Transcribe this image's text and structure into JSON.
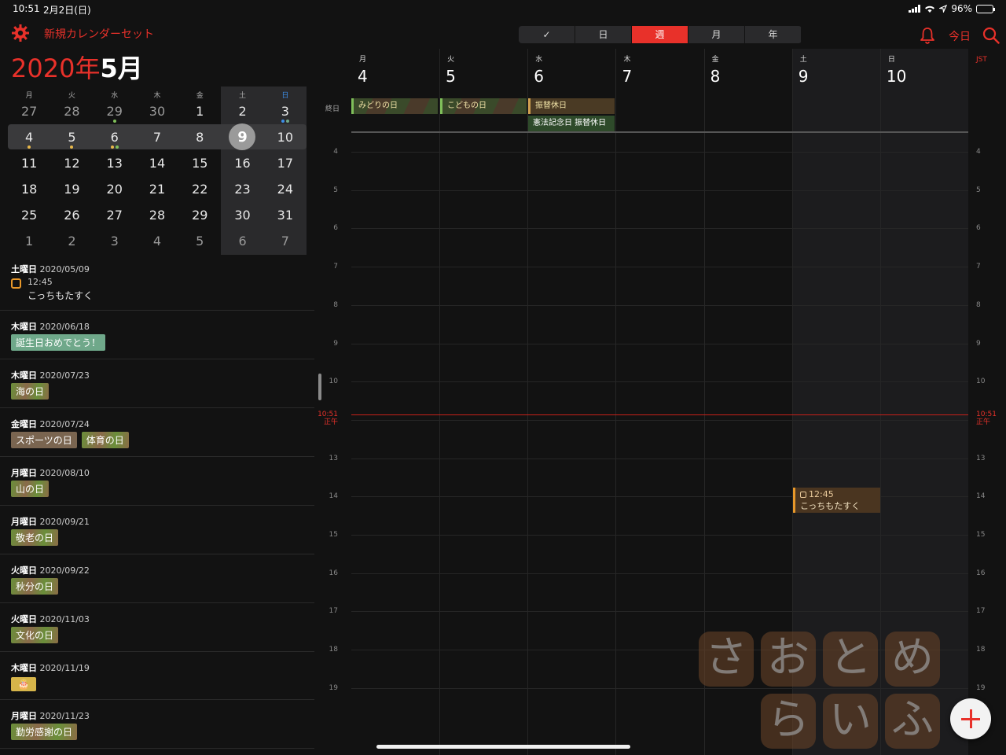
{
  "status": {
    "time": "10:51",
    "date": "2月2日(日)",
    "battery": "96%",
    "battery_level": 0.96
  },
  "left": {
    "calendar_set": "新規カレンダーセット",
    "year": "2020年",
    "month": "5月"
  },
  "minical": {
    "weekdays": [
      "月",
      "火",
      "水",
      "木",
      "金",
      "土",
      "日"
    ],
    "rows": [
      [
        "27",
        "28",
        "29",
        "30",
        "1",
        "2",
        "3"
      ],
      [
        "4",
        "5",
        "6",
        "7",
        "8",
        "9",
        "10"
      ],
      [
        "11",
        "12",
        "13",
        "14",
        "15",
        "16",
        "17"
      ],
      [
        "18",
        "19",
        "20",
        "21",
        "22",
        "23",
        "24"
      ],
      [
        "25",
        "26",
        "27",
        "28",
        "29",
        "30",
        "31"
      ],
      [
        "1",
        "2",
        "3",
        "4",
        "5",
        "6",
        "7"
      ]
    ],
    "today": "9"
  },
  "agenda": [
    {
      "weekday": "土曜日",
      "date": "2020/05/09",
      "task_time": "12:45",
      "task_title": "こっちもたすく"
    },
    {
      "weekday": "木曜日",
      "date": "2020/06/18",
      "chips": [
        "誕生日おめでとう！"
      ]
    },
    {
      "weekday": "木曜日",
      "date": "2020/07/23",
      "chips": [
        "海の日"
      ]
    },
    {
      "weekday": "金曜日",
      "date": "2020/07/24",
      "chips": [
        "スポーツの日",
        "体育の日"
      ]
    },
    {
      "weekday": "月曜日",
      "date": "2020/08/10",
      "chips": [
        "山の日"
      ]
    },
    {
      "weekday": "月曜日",
      "date": "2020/09/21",
      "chips": [
        "敬老の日"
      ]
    },
    {
      "weekday": "火曜日",
      "date": "2020/09/22",
      "chips": [
        "秋分の日"
      ]
    },
    {
      "weekday": "火曜日",
      "date": "2020/11/03",
      "chips": [
        "文化の日"
      ]
    },
    {
      "weekday": "木曜日",
      "date": "2020/11/19",
      "chips": [
        "🎂"
      ]
    },
    {
      "weekday": "月曜日",
      "date": "2020/11/23",
      "chips": [
        "勤労感謝の日"
      ]
    }
  ],
  "toolbar": {
    "segments": [
      "✓",
      "日",
      "週",
      "月",
      "年"
    ],
    "active_segment": "週",
    "today_label": "今日"
  },
  "week": {
    "days": [
      {
        "wd": "月",
        "num": "4"
      },
      {
        "wd": "火",
        "num": "5"
      },
      {
        "wd": "水",
        "num": "6"
      },
      {
        "wd": "木",
        "num": "7"
      },
      {
        "wd": "金",
        "num": "8"
      },
      {
        "wd": "土",
        "num": "9"
      },
      {
        "wd": "日",
        "num": "10"
      }
    ],
    "allday_label": "終日",
    "timezone": "JST",
    "now_label": "10:51",
    "noon_label": "正午",
    "hours": [
      "4",
      "5",
      "6",
      "7",
      "8",
      "9",
      "10",
      "正午",
      "13",
      "14",
      "15",
      "16",
      "17",
      "18",
      "19"
    ],
    "allday_events": [
      "みどりの日",
      "こどもの日",
      "振替休日",
      "憲法記念日 振替休日"
    ],
    "timed_event": {
      "time": "12:45",
      "title": "こっちもたすく"
    }
  },
  "watermark": [
    "さ",
    "お",
    "と",
    "め",
    "ら",
    "い",
    "ふ"
  ]
}
